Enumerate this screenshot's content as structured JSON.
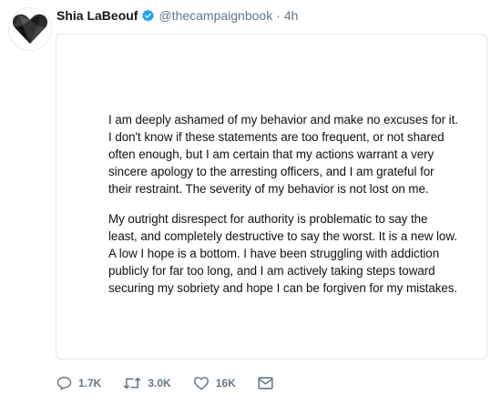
{
  "author": {
    "name": "Shia LaBeouf",
    "handle": "@thecampaignbook",
    "separator": "·",
    "time": "4h"
  },
  "statement": {
    "paragraph1": "I am deeply ashamed of my behavior and make no excuses for it.\nI don't know if these statements are too frequent, or not shared\noften enough, but I am certain that my actions warrant a very\nsincere apology to the arresting officers, and I am grateful for\ntheir restraint. The severity of my behavior is not lost on me.",
    "paragraph2": "My outright disrespect for authority is problematic to say the\nleast, and completely destructive to say the worst. It is a new low.\nA low I hope is a bottom. I have been struggling with addiction\npublicly for far too long, and I am actively taking steps toward\nsecuring my sobriety and hope I can be forgiven for my mistakes."
  },
  "actions": {
    "replies": "1.7K",
    "retweets": "3.0K",
    "likes": "16K"
  },
  "colors": {
    "verified": "#1da1f2",
    "muted": "#657786",
    "border": "#e1e8ed"
  },
  "icons": {
    "reply": "reply-icon",
    "retweet": "retweet-icon",
    "like": "heart-icon",
    "message": "envelope-icon",
    "verified": "verified-badge-icon"
  }
}
